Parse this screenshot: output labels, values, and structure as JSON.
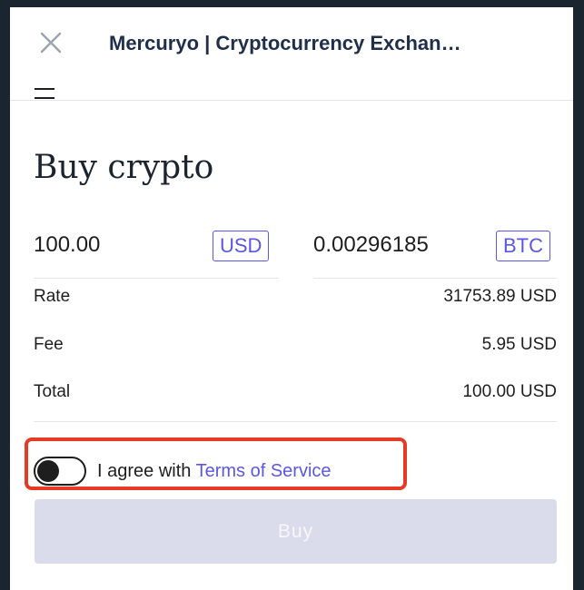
{
  "window": {
    "title": "Mercuryo | Cryptocurrency Exchan…",
    "close_icon": "close-icon",
    "menu_icon": "menu-icon"
  },
  "page": {
    "heading": "Buy crypto"
  },
  "exchange": {
    "spend": {
      "value": "100.00",
      "currency": "USD"
    },
    "receive": {
      "value": "0.00296185",
      "currency": "BTC"
    }
  },
  "details": {
    "rate": {
      "label": "Rate",
      "value": "31753.89 USD"
    },
    "fee": {
      "label": "Fee",
      "value": "5.95 USD"
    },
    "total": {
      "label": "Total",
      "value": "100.00 USD"
    }
  },
  "terms": {
    "prefix": "I agree with ",
    "link": "Terms of Service",
    "checked": false
  },
  "buy_button": {
    "label": "Buy",
    "disabled": true
  },
  "colors": {
    "accent": "#5b57e6",
    "highlight": "#e63a24",
    "backdrop": "#1b2530",
    "disabled_button": "#dadbeb"
  }
}
